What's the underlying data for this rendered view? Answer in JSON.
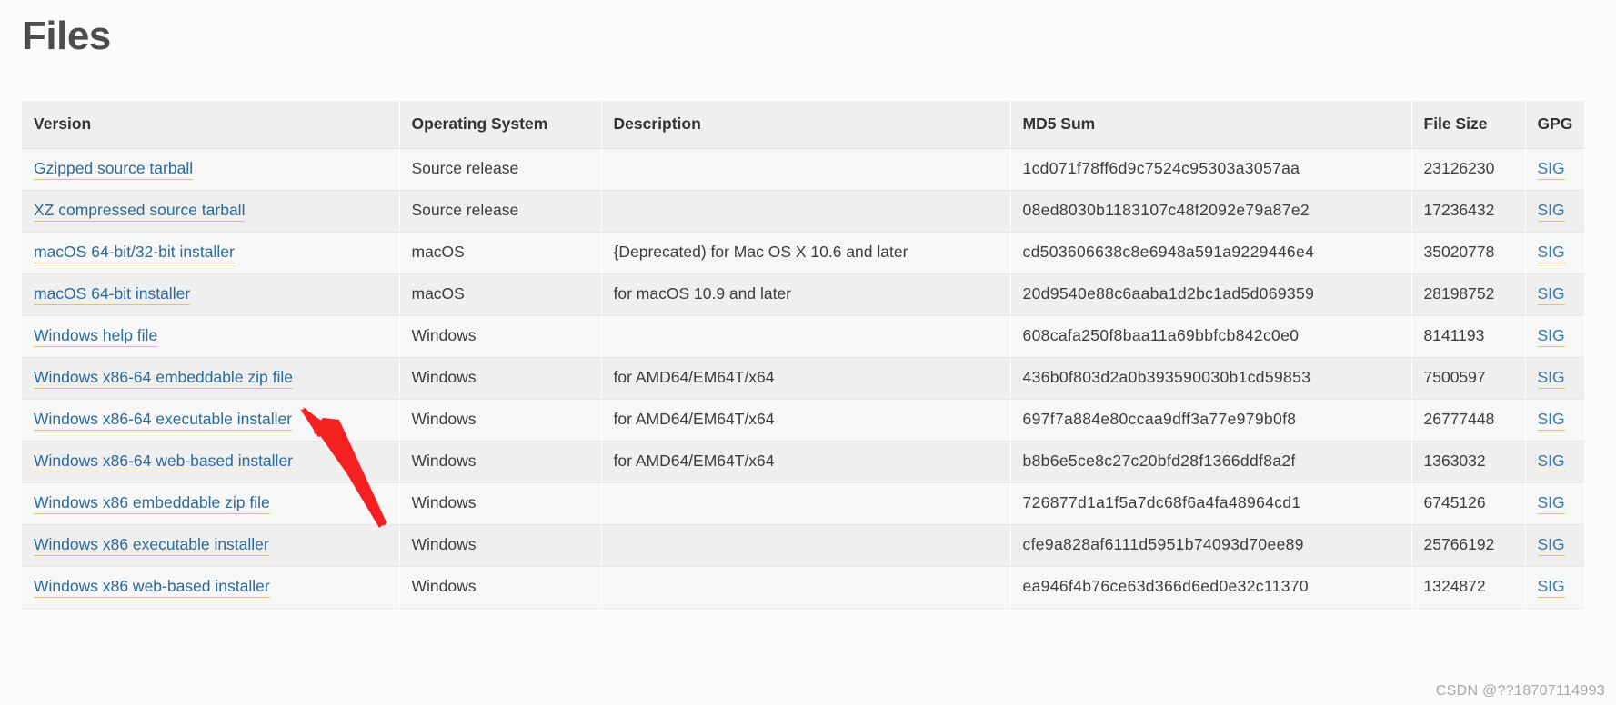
{
  "page": {
    "title": "Files",
    "watermark": "CSDN @??18707114993"
  },
  "table": {
    "headers": {
      "version": "Version",
      "os": "Operating System",
      "description": "Description",
      "md5": "MD5 Sum",
      "size": "File Size",
      "gpg": "GPG"
    },
    "sig_label": "SIG",
    "rows": [
      {
        "version": "Gzipped source tarball",
        "os": "Source release",
        "description": "",
        "md5": "1cd071f78ff6d9c7524c95303a3057aa",
        "size": "23126230",
        "gpg": "SIG"
      },
      {
        "version": "XZ compressed source tarball",
        "os": "Source release",
        "description": "",
        "md5": "08ed8030b1183107c48f2092e79a87e2",
        "size": "17236432",
        "gpg": "SIG"
      },
      {
        "version": "macOS 64-bit/32-bit installer",
        "os": "macOS",
        "description": "{Deprecated) for Mac OS X 10.6 and later",
        "md5": "cd503606638c8e6948a591a9229446e4",
        "size": "35020778",
        "gpg": "SIG"
      },
      {
        "version": "macOS 64-bit installer",
        "os": "macOS",
        "description": "for macOS 10.9 and later",
        "md5": "20d9540e88c6aaba1d2bc1ad5d069359",
        "size": "28198752",
        "gpg": "SIG"
      },
      {
        "version": "Windows help file",
        "os": "Windows",
        "description": "",
        "md5": "608cafa250f8baa11a69bbfcb842c0e0",
        "size": "8141193",
        "gpg": "SIG"
      },
      {
        "version": "Windows x86-64 embeddable zip file",
        "os": "Windows",
        "description": "for AMD64/EM64T/x64",
        "md5": "436b0f803d2a0b393590030b1cd59853",
        "size": "7500597",
        "gpg": "SIG"
      },
      {
        "version": "Windows x86-64 executable installer",
        "os": "Windows",
        "description": "for AMD64/EM64T/x64",
        "md5": "697f7a884e80ccaa9dff3a77e979b0f8",
        "size": "26777448",
        "gpg": "SIG"
      },
      {
        "version": "Windows x86-64 web-based installer",
        "os": "Windows",
        "description": "for AMD64/EM64T/x64",
        "md5": "b8b6e5ce8c27c20bfd28f1366ddf8a2f",
        "size": "1363032",
        "gpg": "SIG"
      },
      {
        "version": "Windows x86 embeddable zip file",
        "os": "Windows",
        "description": "",
        "md5": "726877d1a1f5a7dc68f6a4fa48964cd1",
        "size": "6745126",
        "gpg": "SIG"
      },
      {
        "version": "Windows x86 executable installer",
        "os": "Windows",
        "description": "",
        "md5": "cfe9a828af6111d5951b74093d70ee89",
        "size": "25766192",
        "gpg": "SIG"
      },
      {
        "version": "Windows x86 web-based installer",
        "os": "Windows",
        "description": "",
        "md5": "ea946f4b76ce63d366d6ed0e32c11370",
        "size": "1324872",
        "gpg": "SIG"
      }
    ]
  },
  "annotation": {
    "type": "red-arrow",
    "color": "#f52020",
    "points_to": "Windows x86-64 executable installer"
  }
}
